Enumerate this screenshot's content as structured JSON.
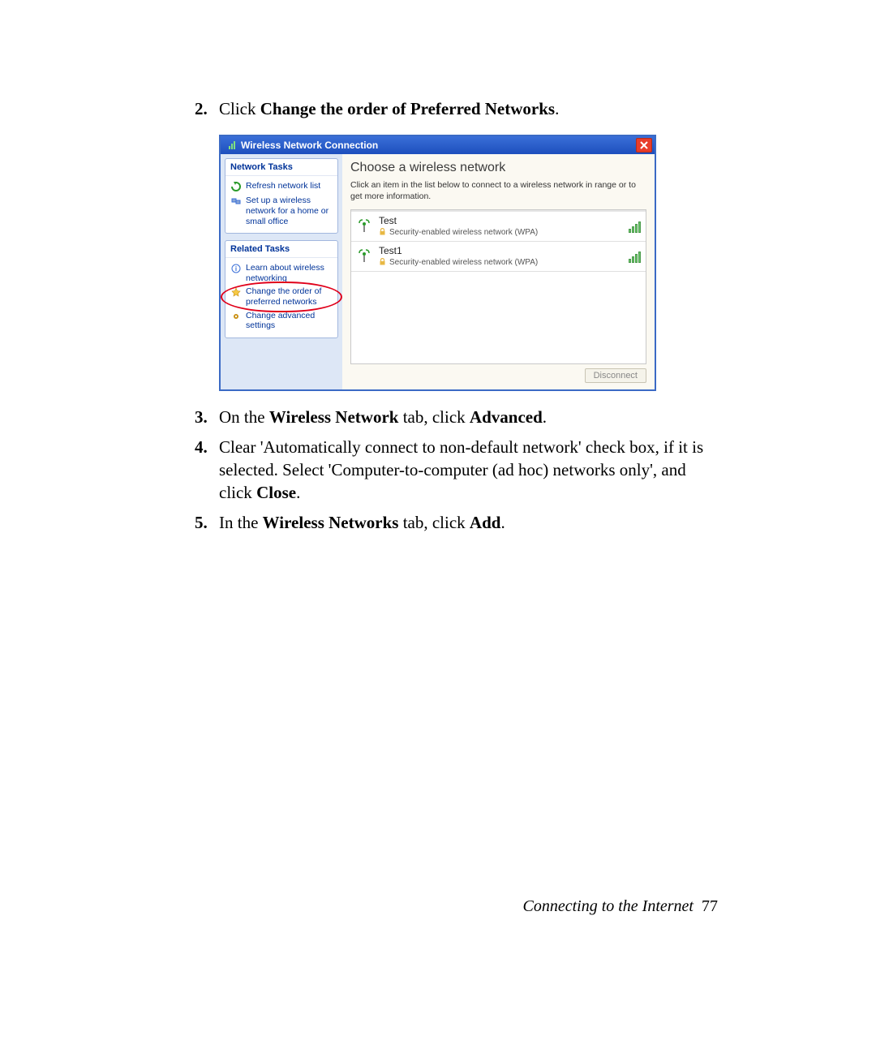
{
  "steps": {
    "s2": {
      "num": "2.",
      "before": "Click ",
      "bold": "Change the order of Preferred Networks",
      "after": "."
    },
    "s3": {
      "num": "3.",
      "before": "On the ",
      "bold": "Wireless Network",
      "mid": " tab, click ",
      "bold2": "Advanced",
      "after": "."
    },
    "s4": {
      "num": "4.",
      "text": "Clear 'Automatically connect to non-default network' check box, if it is selected. Select 'Computer-to-computer (ad hoc) networks only', and click ",
      "bold": "Close",
      "after": "."
    },
    "s5": {
      "num": "5.",
      "before": "In the ",
      "bold": "Wireless Networks",
      "mid": " tab, click ",
      "bold2": "Add",
      "after": "."
    }
  },
  "win": {
    "title": "Wireless Network Connection",
    "left": {
      "tasks_header": "Network Tasks",
      "task_refresh": "Refresh network list",
      "task_setup": "Set up a wireless network for a home or small office",
      "related_header": "Related Tasks",
      "rel_learn": "Learn about wireless networking",
      "rel_order": "Change the order of preferred networks",
      "rel_adv": "Change advanced settings"
    },
    "right": {
      "header": "Choose a wireless network",
      "sub": "Click an item in the list below to connect to a wireless network in range or to get more information.",
      "net1": {
        "name": "Test",
        "sec": "Security-enabled wireless network (WPA)"
      },
      "net2": {
        "name": "Test1",
        "sec": "Security-enabled wireless network (WPA)"
      },
      "disconnect": "Disconnect"
    }
  },
  "footer": {
    "section": "Connecting to the Internet",
    "page": "77"
  }
}
